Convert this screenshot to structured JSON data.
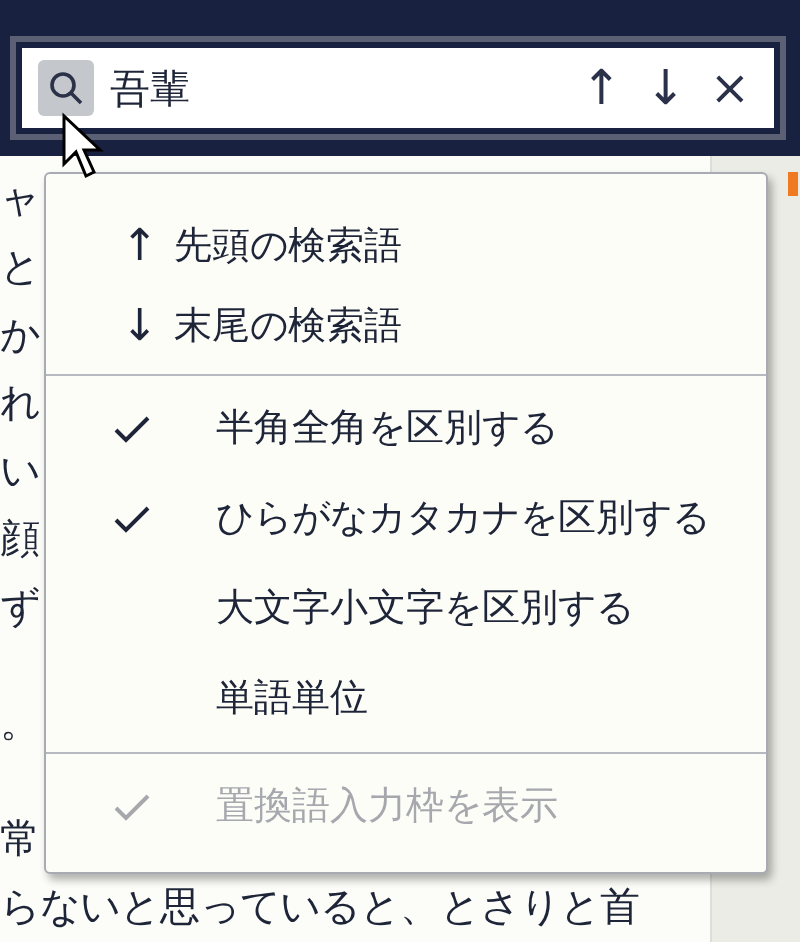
{
  "search": {
    "value": "吾輩",
    "buttons": [
      "↑",
      "↓",
      "×"
    ]
  },
  "document": {
    "paragraphs": [
      {
        "lines": [
          "ャ",
          "と",
          "か",
          "れ",
          "い",
          "顔",
          "ず"
        ]
      },
      {
        "lines": [
          "。"
        ]
      },
      {
        "lines": [
          "常",
          "らないと思っていると、とさりと首"
        ]
      }
    ]
  },
  "menu": {
    "sections": [
      [
        {
          "kind": "command",
          "icon": "↑",
          "label": "先頭の検索語",
          "disabled": false
        },
        {
          "kind": "command",
          "icon": "↓",
          "label": "末尾の検索語",
          "disabled": false
        }
      ],
      [
        {
          "kind": "toggle",
          "label": "半角全角を区別する",
          "checked": true,
          "disabled": false
        },
        {
          "kind": "toggle",
          "label": "ひらがなカタカナを区別する",
          "checked": true,
          "disabled": false
        },
        {
          "kind": "toggle",
          "label": "大文字小文字を区別する",
          "checked": false,
          "disabled": false
        },
        {
          "kind": "toggle",
          "label": "単語単位",
          "checked": false,
          "disabled": false
        }
      ],
      [
        {
          "kind": "toggle",
          "label": "置換語入力枠を表示",
          "checked": true,
          "disabled": true
        }
      ]
    ]
  }
}
